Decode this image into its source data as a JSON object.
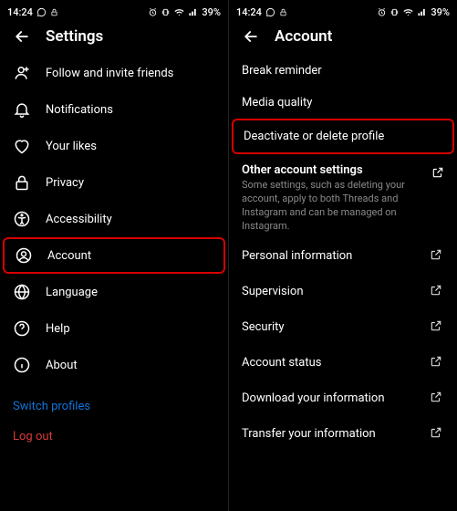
{
  "status": {
    "time": "14:24",
    "battery": "39%"
  },
  "settings": {
    "title": "Settings",
    "items": [
      "Follow and invite friends",
      "Notifications",
      "Your likes",
      "Privacy",
      "Accessibility",
      "Account",
      "Language",
      "Help",
      "About"
    ],
    "switch_profiles": "Switch profiles",
    "log_out": "Log out"
  },
  "account": {
    "title": "Account",
    "break_reminder": "Break reminder",
    "media_quality": "Media quality",
    "deactivate": "Deactivate or delete profile",
    "other_title": "Other account settings",
    "other_desc": "Some settings, such as deleting your account, apply to both Threads and Instagram and can be managed on Instagram.",
    "personal_info": "Personal information",
    "supervision": "Supervision",
    "security": "Security",
    "account_status": "Account status",
    "download": "Download your information",
    "transfer": "Transfer your information"
  }
}
